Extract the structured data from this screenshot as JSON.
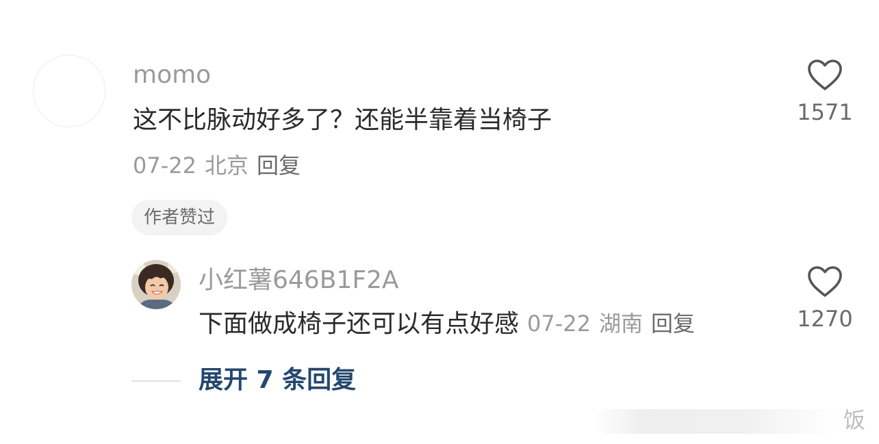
{
  "comment": {
    "username": "momo",
    "text": "这不比脉动好多了？还能半靠着当椅子",
    "date": "07-22",
    "location": "北京",
    "reply_label": "回复",
    "badge": "作者赞过",
    "like_count": "1571",
    "like_icon": "heart-outline-icon"
  },
  "reply": {
    "username": "小红薯646B1F2A",
    "text": "下面做成椅子还可以有点好感",
    "date": "07-22",
    "location": "湖南",
    "reply_label": "回复",
    "like_count": "1270",
    "like_icon": "heart-outline-icon"
  },
  "expand": {
    "label": "展开 7 条回复",
    "color": "#24476e"
  },
  "watermark": {
    "text": "饭"
  }
}
